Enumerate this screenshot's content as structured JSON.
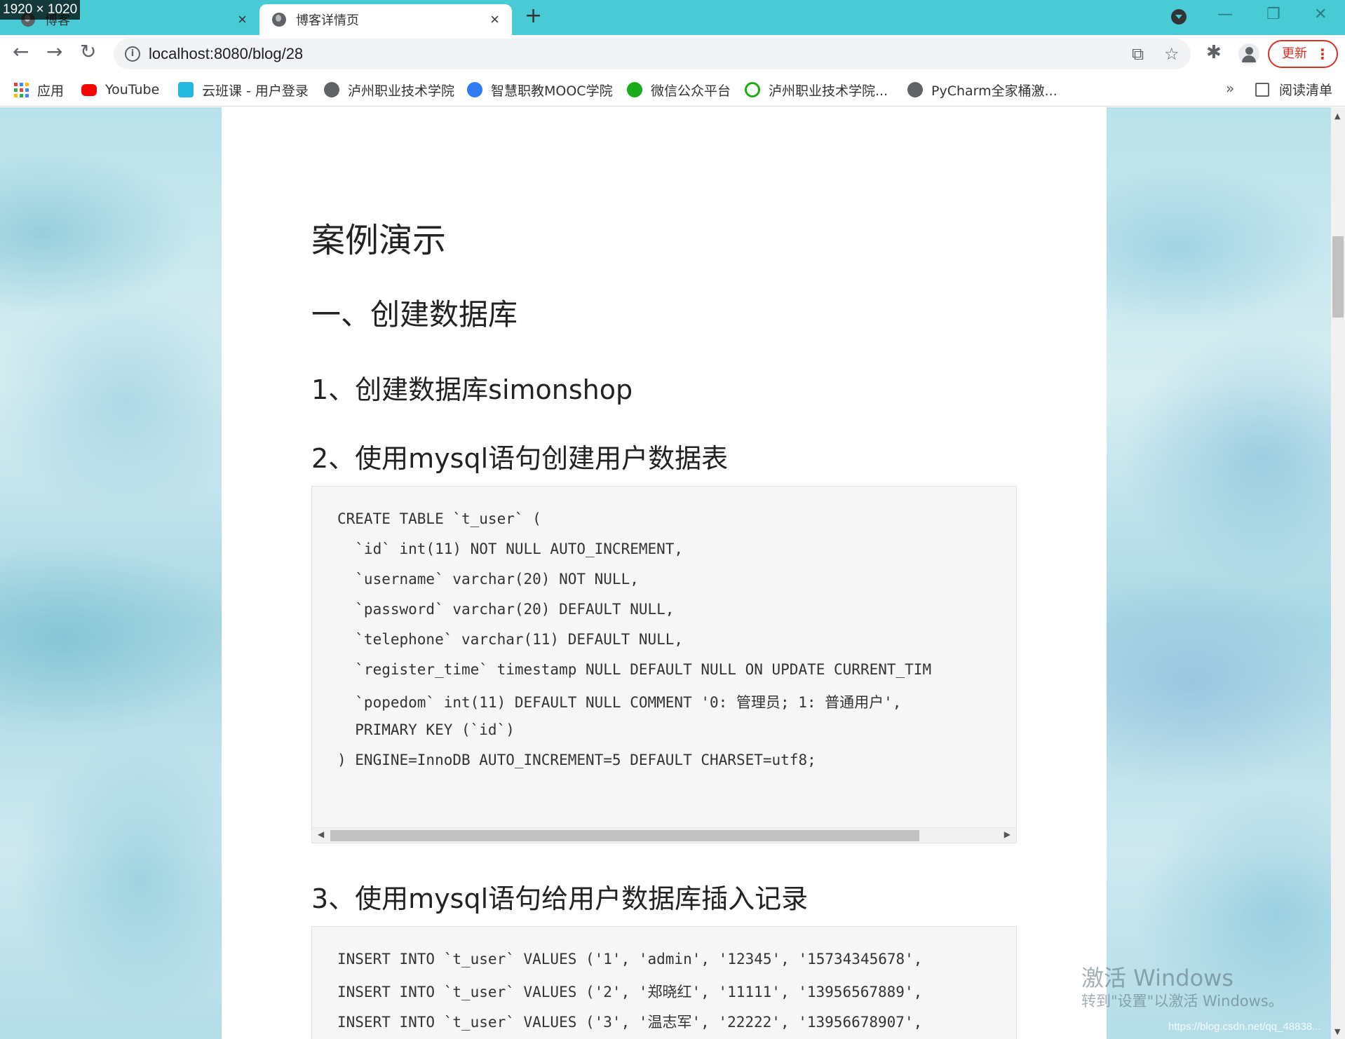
{
  "screen_label": "1920 × 1020",
  "tabs": [
    {
      "title": "博客",
      "active": false
    },
    {
      "title": "博客详情页",
      "active": true
    }
  ],
  "toolbar": {
    "url": "localhost:8080/blog/28",
    "update_label": "更新"
  },
  "bookmarks": {
    "items": [
      {
        "label": "应用",
        "icon": "apps-grid-icon"
      },
      {
        "label": "YouTube",
        "icon": "youtube-icon"
      },
      {
        "label": "云班课 - 用户登录",
        "icon": "cloud-class-icon"
      },
      {
        "label": "泸州职业技术学院",
        "icon": "globe-icon"
      },
      {
        "label": "智慧职教MOOC学院",
        "icon": "mooc-icon"
      },
      {
        "label": "微信公众平台",
        "icon": "wechat-icon"
      },
      {
        "label": "泸州职业技术学院...",
        "icon": "lzy-icon"
      },
      {
        "label": "PyCharm全家桶激...",
        "icon": "globe-icon"
      }
    ],
    "more": "»",
    "reading_list": "阅读清单"
  },
  "article": {
    "title": "案例演示",
    "section": "一、创建数据库",
    "steps": [
      "1、创建数据库simonshop",
      "2、使用mysql语句创建用户数据表",
      "3、使用mysql语句给用户数据库插入记录"
    ],
    "code_create": [
      "CREATE TABLE `t_user` (",
      "  `id` int(11) NOT NULL AUTO_INCREMENT,",
      "  `username` varchar(20) NOT NULL,",
      "  `password` varchar(20) DEFAULT NULL,",
      "  `telephone` varchar(11) DEFAULT NULL,",
      "  `register_time` timestamp NULL DEFAULT NULL ON UPDATE CURRENT_TIM",
      "  `popedom` int(11) DEFAULT NULL COMMENT '0: 管理员; 1: 普通用户',",
      "  PRIMARY KEY (`id`)",
      ") ENGINE=InnoDB AUTO_INCREMENT=5 DEFAULT CHARSET=utf8;"
    ],
    "code_insert": [
      "INSERT INTO `t_user` VALUES ('1', 'admin', '12345', '15734345678',",
      "INSERT INTO `t_user` VALUES ('2', '郑晓红', '11111', '13956567889',",
      "INSERT INTO `t_user` VALUES ('3', '温志军', '22222', '13956678907',"
    ]
  },
  "watermark": {
    "line1": "激活 Windows",
    "line2": "转到\"设置\"以激活 Windows。",
    "line3": "https://blog.csdn.net/qq_48838..."
  }
}
